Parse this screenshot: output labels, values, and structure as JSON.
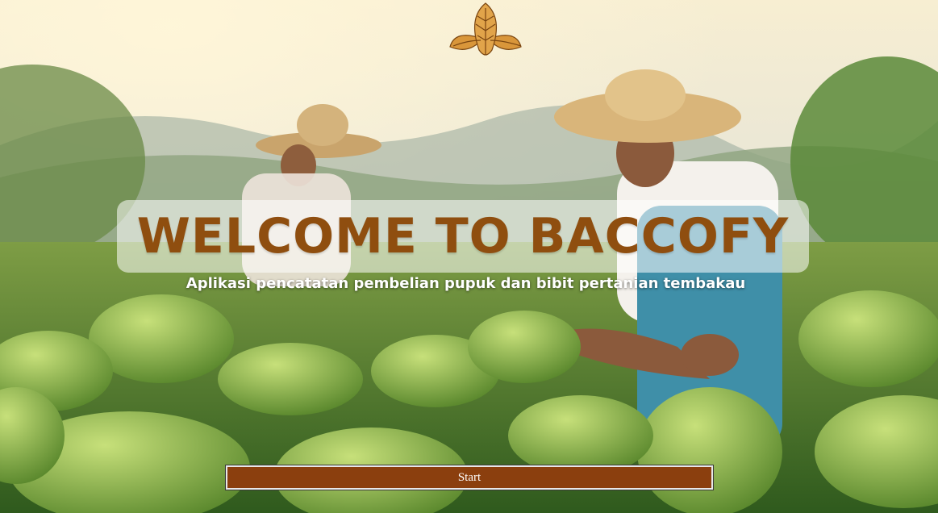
{
  "header": {
    "logo": "tobacco-leaves-logo"
  },
  "hero": {
    "title": "WELCOME TO BACCOFY",
    "subtitle": "Aplikasi pencatatan pembelian pupuk dan bibit pertanian tembakau"
  },
  "actions": {
    "start_label": "Start"
  },
  "colors": {
    "title": "#8f4e0f",
    "button_bg": "#8b3f0e",
    "button_text": "#ffffff",
    "subtitle": "#ffffff"
  }
}
